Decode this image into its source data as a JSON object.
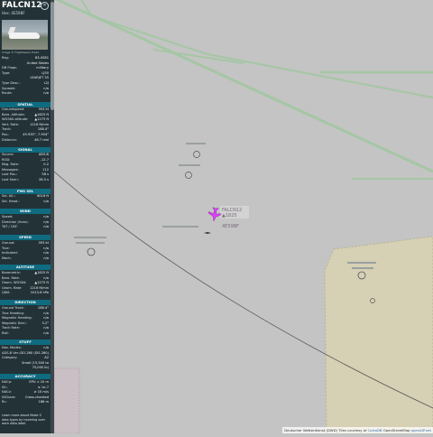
{
  "header": {
    "callsign": "FALCN12",
    "hex_label": "Hex:",
    "hex": "4E59BF"
  },
  "photo": {
    "credit": "Image © FlightAware Trade"
  },
  "info_rows": [
    {
      "k": "Reg:",
      "v": "83-0081"
    },
    {
      "k": "",
      "v": "United States"
    },
    {
      "k": "DB Flags:",
      "v": "military"
    },
    {
      "k": "Type:",
      "v": "LJ35"
    },
    {
      "k": "",
      "v": "LEARJET 35"
    },
    {
      "k": "Type Desc.:",
      "v": "L2J"
    },
    {
      "k": "Squawk:",
      "v": "n/a"
    },
    {
      "k": "Route:",
      "v": "n/a"
    }
  ],
  "sections": {
    "spatial": {
      "title": "SPATIAL",
      "rows": [
        {
          "k": "Groundspeed:",
          "v": "393 kt"
        },
        {
          "k": "Baro. Altitude:",
          "v": "▲1825 ft"
        },
        {
          "k": "WGS84 altitude:",
          "v": "▲1275 ft"
        },
        {
          "k": "Vert. Rate:",
          "v": "1216 ft/min"
        },
        {
          "k": "Track:",
          "v": "188.4°"
        },
        {
          "k": "Pos.:",
          "v": "49.935°, 7.954°"
        },
        {
          "k": "Distance:",
          "v": "46.7 nmi"
        }
      ]
    },
    "signal": {
      "title": "SIGNAL",
      "rows": [
        {
          "k": "Source:",
          "v": "ADS-B"
        },
        {
          "k": "RSSI:",
          "v": "-12.7"
        },
        {
          "k": "Msg. Rate:",
          "v": "0.2"
        },
        {
          "k": "Messages:",
          "v": "112"
        },
        {
          "k": "Last Pos.:",
          "v": "58 s"
        },
        {
          "k": "Last Seen:",
          "v": "28.3 s"
        }
      ]
    },
    "fms_sel": {
      "title": "FMS SEL",
      "rows": [
        {
          "k": "Sel. Alt.:",
          "v": "6016 ft"
        },
        {
          "k": "Sel. Head.:",
          "v": "n/a"
        }
      ]
    },
    "wind": {
      "title": "WIND",
      "rows": [
        {
          "k": "Speed:",
          "v": "n/a"
        },
        {
          "k": "Direction (from):",
          "v": "n/a"
        },
        {
          "k": "TAT / OAT:",
          "v": "n/a"
        }
      ]
    },
    "speed": {
      "title": "SPEED",
      "rows": [
        {
          "k": "Ground:",
          "v": "393 kt"
        },
        {
          "k": "True:",
          "v": "n/a"
        },
        {
          "k": "Indicated:",
          "v": "n/a"
        },
        {
          "k": "Mach:",
          "v": "n/a"
        }
      ]
    },
    "altitude": {
      "title": "ALTITUDE",
      "rows": [
        {
          "k": "Barometric:",
          "v": "▲1825 ft"
        },
        {
          "k": "Baro. Rate:",
          "v": "n/a"
        },
        {
          "k": "Geom. WGS84:",
          "v": "▲1275 ft"
        },
        {
          "k": "Geom. Rate:",
          "v": "1216 ft/min"
        },
        {
          "k": "QNH:",
          "v": "1013.6 hPa"
        }
      ]
    },
    "direction": {
      "title": "DIRECTION",
      "rows": [
        {
          "k": "Ground Track:",
          "v": "188.4°"
        },
        {
          "k": "True Heading:",
          "v": "n/a"
        },
        {
          "k": "Magnetic Heading:",
          "v": "n/a"
        },
        {
          "k": "Magnetic Decl.:",
          "v": "3.2°"
        },
        {
          "k": "Track Rate:",
          "v": "n/a"
        },
        {
          "k": "Roll:",
          "v": "n/a"
        }
      ]
    },
    "stuff": {
      "title": "STUFF",
      "rows": [
        {
          "k": "Nav. Modes:",
          "v": "n/a"
        },
        {
          "k": "ADS-B Ver.:",
          "v": "DO-260 (DO-260)"
        },
        {
          "k": "Category:",
          "v": "A2"
        },
        {
          "k": "",
          "v": "Small (15,500 to"
        },
        {
          "k": "",
          "v": "75,000 lb)"
        }
      ]
    },
    "accuracy": {
      "title": "ACCURACY",
      "rows": [
        {
          "k": "NACp:",
          "v": "EPU < 10 m"
        },
        {
          "k": "SIL:",
          "v": "≤ 1e-7"
        },
        {
          "k": "NACv:",
          "v": "≥ 10 m/s"
        },
        {
          "k": "NICbaro:",
          "v": "Cross-checked"
        },
        {
          "k": "Rc:",
          "v": "186 m"
        }
      ]
    }
  },
  "note": "Learn more about Mode S data types by hovering over each data label.",
  "map": {
    "aircraft_label_1": "FALCN12",
    "aircraft_label_2": "▲1825",
    "aircraft_label_3": "4E59BF",
    "attribution_prefix": "Deutscher Wetterdienst (DWD) Tiles courtesy of",
    "attribution_link1": "CartoDB",
    "attribution_mid": "OpenStreetMap",
    "attribution_link2": "openAIP.net",
    "colors": {
      "ground": "#c3c4c3",
      "green_line": "#a5c6a5",
      "restricted_area": "#d6d0b4",
      "aircraft": "#e040fb",
      "range_ring": "#5a5a5a"
    }
  }
}
